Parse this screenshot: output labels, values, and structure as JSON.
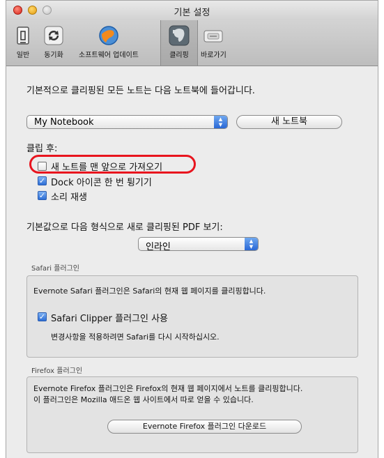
{
  "window": {
    "title": "기본 설정"
  },
  "toolbar": {
    "items": [
      {
        "label": "일반",
        "icon": "general-icon"
      },
      {
        "label": "동기화",
        "icon": "sync-icon"
      },
      {
        "label": "소프트웨어 업데이트",
        "icon": "software-update-icon"
      },
      {
        "label": "클리핑",
        "icon": "evernote-elephant-icon",
        "selected": true
      },
      {
        "label": "바로가기",
        "icon": "keyboard-shortcut-icon"
      }
    ]
  },
  "clipping": {
    "intro": "기본적으로 클리핑된 모든 노트는 다음 노트북에 들어갑니다.",
    "notebook_select": "My Notebook",
    "new_notebook_button": "새 노트북",
    "after_clip_label": "클립 후:",
    "options": [
      {
        "label": "새 노트를 맨 앞으로 가져오기",
        "checked": false
      },
      {
        "label": "Dock 아이콘 한 번 튕기기",
        "checked": true
      },
      {
        "label": "소리 재생",
        "checked": true
      }
    ],
    "pdf_label": "기본값으로 다음 형식으로 새로 클리핑된 PDF 보기:",
    "pdf_select": "인라인"
  },
  "safari": {
    "group_label": "Safari 플러그인",
    "description": "Evernote Safari 플러그인은 Safari의 현재 웹 페이지를 클리핑합니다.",
    "checkbox_label": "Safari Clipper 플러그인 사용",
    "checked": true,
    "note": "변경사항을 적용하려면 Safari를 다시 시작하십시오."
  },
  "firefox": {
    "group_label": "Firefox 플러그인",
    "description_line1": "Evernote Firefox 플러그인은 Firefox의 현재 웹 페이지에서 노트를 클리핑합니다.",
    "description_line2": "이 플러그인은 Mozilla 애드온 웹 사이트에서 따로 얻을 수 있습니다.",
    "download_button": "Evernote Firefox 플러그인 다운로드"
  },
  "colors": {
    "highlight": "#e8141e",
    "accent": "#2e6fd6"
  }
}
